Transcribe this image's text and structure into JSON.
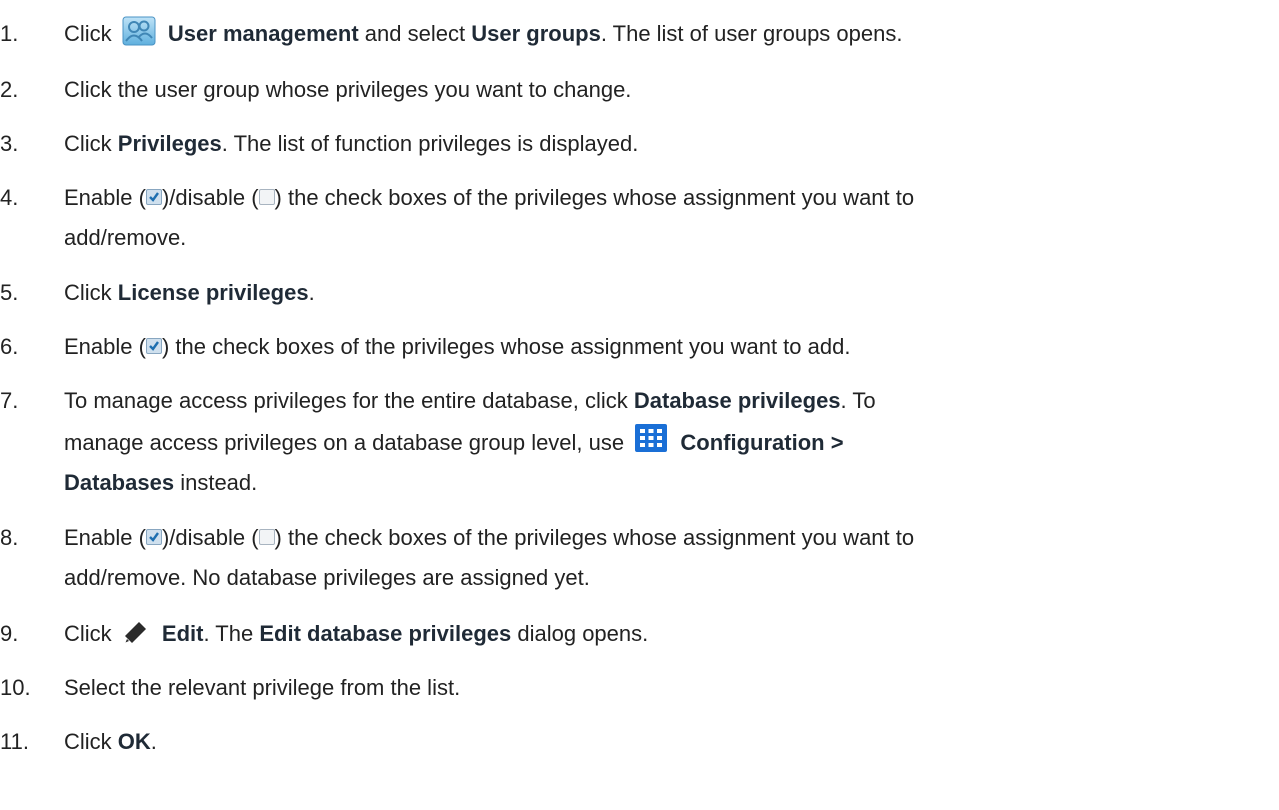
{
  "steps": [
    {
      "num": "1.",
      "a": "Click",
      "b1": "User management",
      "c": "and select",
      "b2": "User groups",
      "d": ". The list of user groups opens.",
      "icon": "users-icon"
    },
    {
      "num": "2.",
      "text": "Click the user group whose privileges you want to change."
    },
    {
      "num": "3.",
      "a": "Click",
      "b1": "Privileges",
      "d": ". The list of function privileges is displayed."
    },
    {
      "num": "4.",
      "a": "Enable (",
      "m1": ")/disable (",
      "m2": ") the check boxes of the privileges whose assignment you want to",
      "line2": "add/remove."
    },
    {
      "num": "5.",
      "a": "Click",
      "b1": "License privileges",
      "d": "."
    },
    {
      "num": "6.",
      "a": "Enable (",
      "m1": ") the check boxes of the privileges whose assignment you want to add."
    },
    {
      "num": "7.",
      "a": "To manage access privileges for the entire database, click",
      "b1": "Database privileges",
      "d": ". To",
      "line2a": "manage access privileges on a database group level, use",
      "icon": "grid-icon",
      "b2": "Configuration >",
      "line3b": "Databases",
      "line3": "instead."
    },
    {
      "num": "8.",
      "a": "Enable (",
      "m1": ")/disable (",
      "m2": ") the check boxes of the privileges whose assignment you want to",
      "line2": "add/remove. No database privileges are assigned yet."
    },
    {
      "num": "9.",
      "a": "Click",
      "icon": "pencil-icon",
      "b1": "Edit",
      "c": ". The",
      "b2": "Edit database privileges",
      "d": "dialog opens."
    },
    {
      "num": "10.",
      "text": "Select the relevant privilege from the list."
    },
    {
      "num": "11.",
      "a": "Click",
      "b1": "OK",
      "d": "."
    }
  ]
}
